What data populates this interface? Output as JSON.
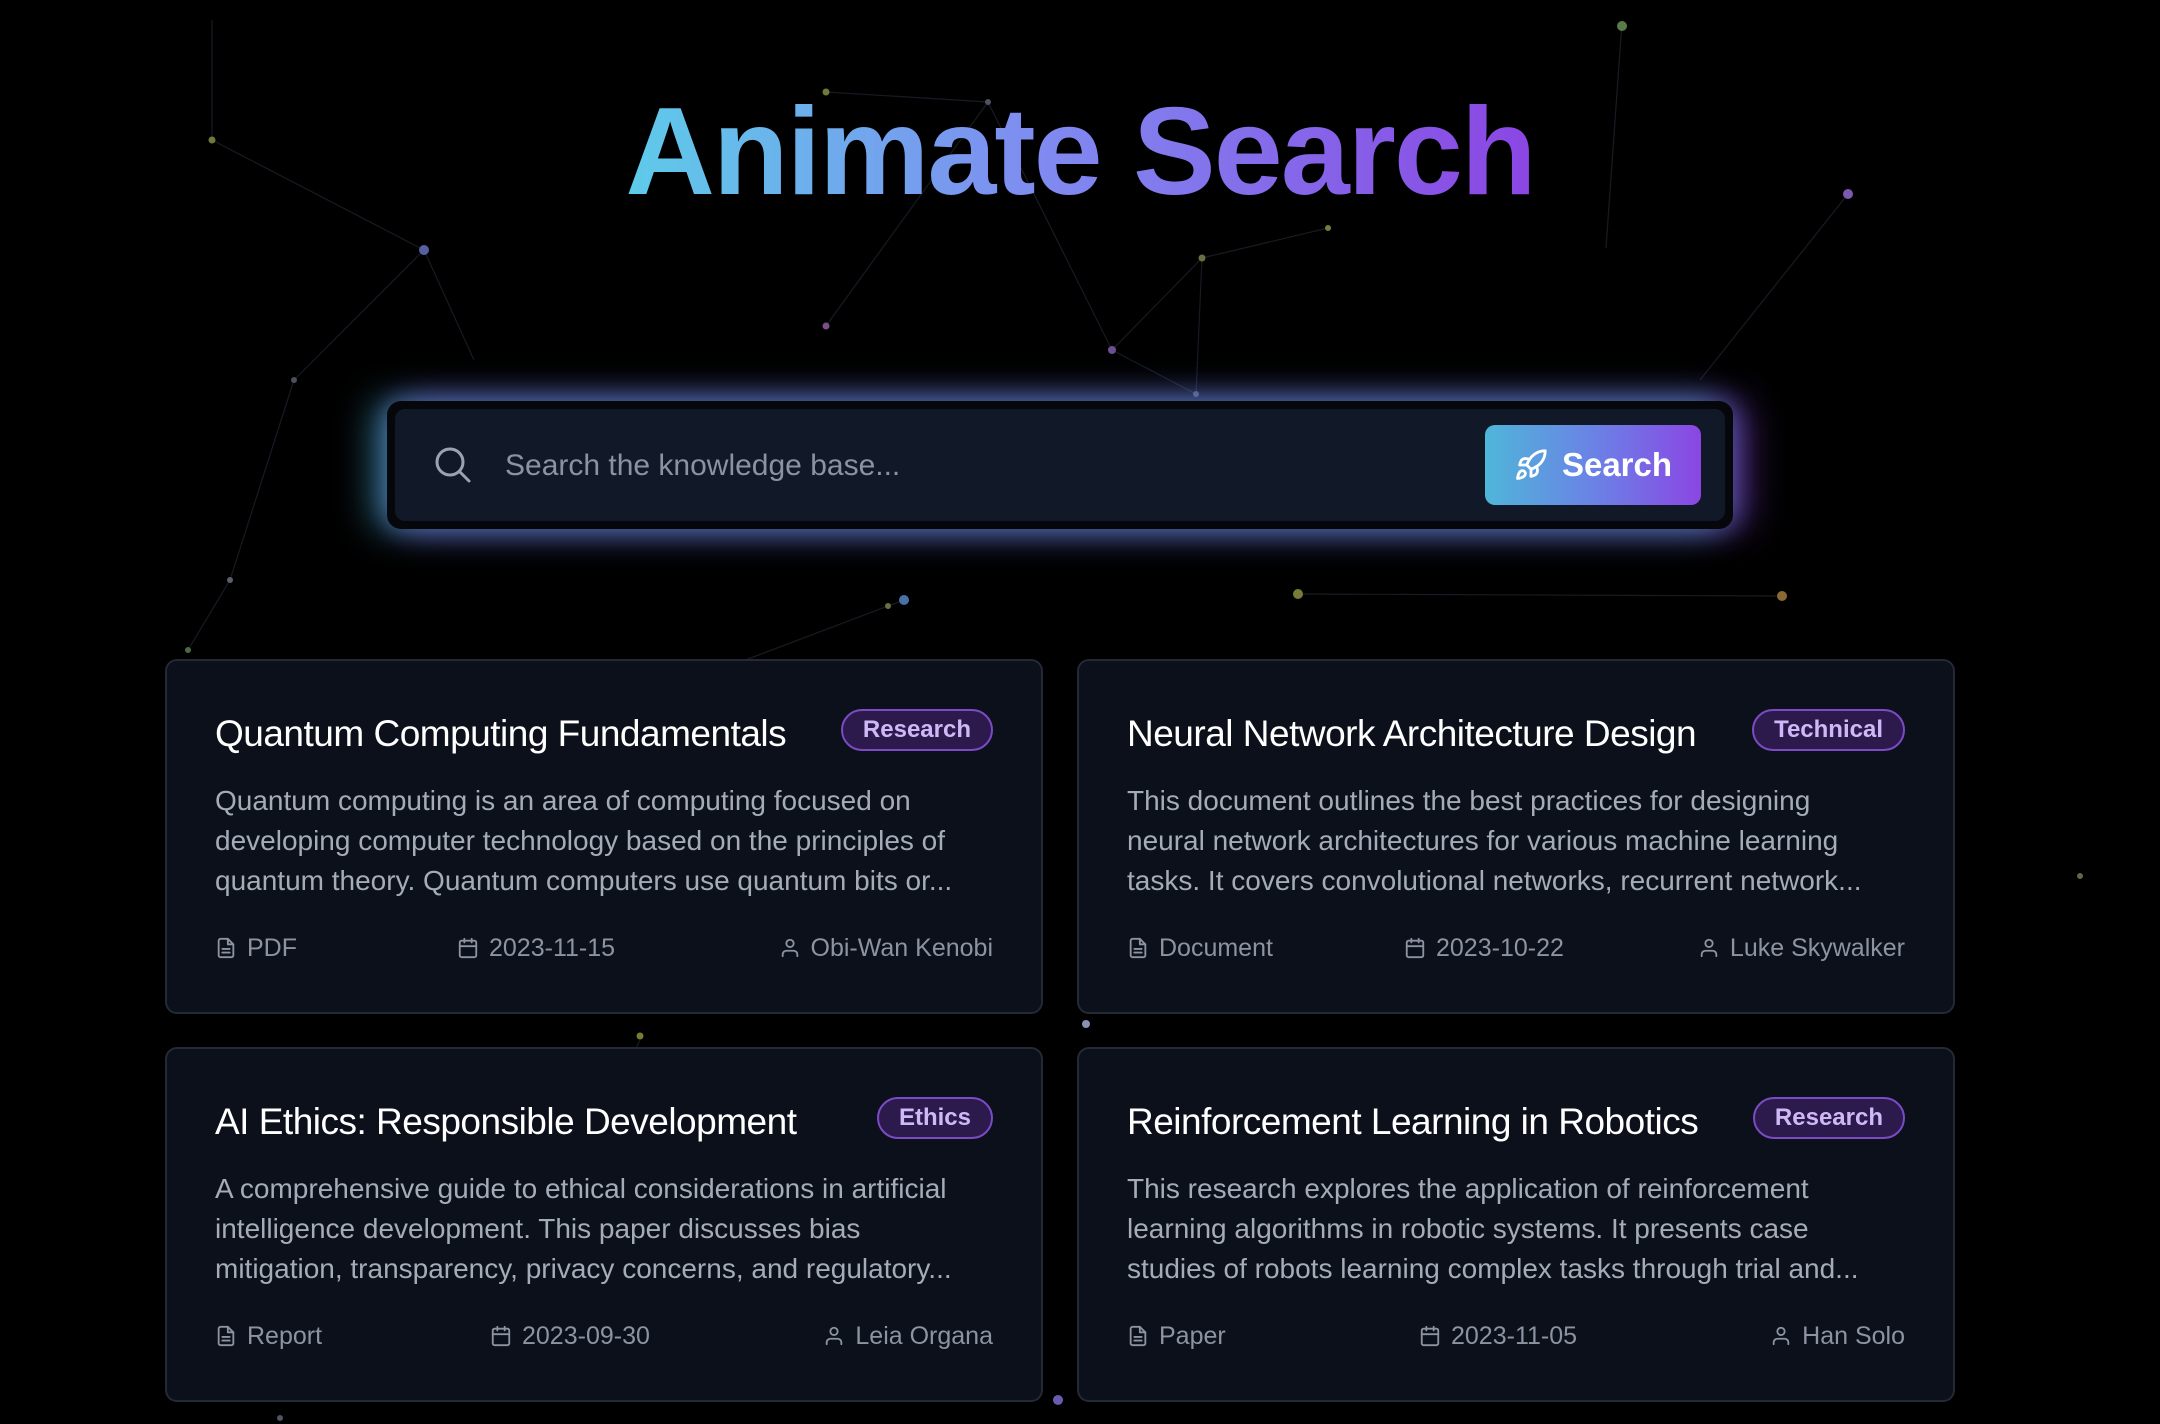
{
  "app": {
    "title": "Animate Search"
  },
  "search": {
    "placeholder": "Search the knowledge base...",
    "value": "",
    "button_label": "Search"
  },
  "results": [
    {
      "title": "Quantum Computing Fundamentals",
      "category": "Research",
      "description_lines": [
        "Quantum computing is an area of computing focused on",
        "developing computer technology based on the principles of",
        "quantum theory. Quantum computers use quantum bits or..."
      ],
      "type": "PDF",
      "date": "2023-11-15",
      "author": "Obi-Wan Kenobi"
    },
    {
      "title": "Neural Network Architecture Design",
      "category": "Technical",
      "description_lines": [
        "This document outlines the best practices for designing",
        "neural network architectures for various machine learning",
        "tasks. It covers convolutional networks, recurrent network..."
      ],
      "type": "Document",
      "date": "2023-10-22",
      "author": "Luke Skywalker"
    },
    {
      "title": "AI Ethics: Responsible Development",
      "category": "Ethics",
      "description_lines": [
        "A comprehensive guide to ethical considerations in artificial",
        "intelligence development. This paper discusses bias",
        "mitigation, transparency, privacy concerns, and regulatory..."
      ],
      "type": "Report",
      "date": "2023-09-30",
      "author": "Leia Organa"
    },
    {
      "title": "Reinforcement Learning in Robotics",
      "category": "Research",
      "description_lines": [
        "This research explores the application of reinforcement",
        "learning algorithms in robotic systems. It presents case",
        "studies of robots learning complex tasks through trial and..."
      ],
      "type": "Paper",
      "date": "2023-11-05",
      "author": "Han Solo"
    }
  ],
  "icons": {
    "search": "search-icon",
    "button": "rocket-icon",
    "type": "file-icon",
    "date": "calendar-icon",
    "author": "user-icon"
  },
  "colors": {
    "background": "#000000",
    "card": "#0c101a",
    "gradient_start": "#5ecbe9",
    "gradient_end": "#8b45e3",
    "badge_text": "#d0b8f7"
  }
}
